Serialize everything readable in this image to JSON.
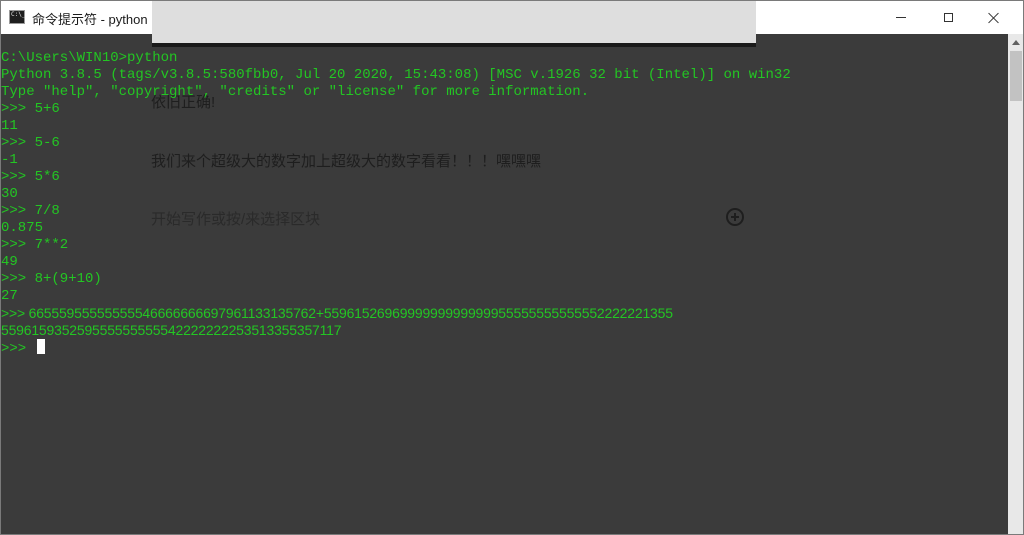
{
  "window": {
    "title": "命令提示符 - python"
  },
  "background_doc": {
    "note_1": "依旧正确!",
    "note_2": "我们来个超级大的数字加上超级大的数字看看！！！嘿嘿嘿",
    "placeholder": "开始写作或按/来选择区块"
  },
  "console": {
    "lines": [
      "C:\\Users\\WIN10>python",
      "Python 3.8.5 (tags/v3.8.5:580fbb0, Jul 20 2020, 15:43:08) [MSC v.1926 32 bit (Intel)] on win32",
      "Type \"help\", \"copyright\", \"credits\" or \"license\" for more information.",
      ">>> 5+6",
      "11",
      ">>> 5-6",
      "-1",
      ">>> 5*6",
      "30",
      ">>> 7/8",
      "0.875",
      ">>> 7**2",
      "49",
      ">>> 8+(9+10)",
      "27",
      ">>> 6655595555555554666666669796113313576​2+5596152696999999999999955555555555552222221355",
      "55961593525955555555554222222225351335535711​7"
    ],
    "prompt": ">>> "
  }
}
